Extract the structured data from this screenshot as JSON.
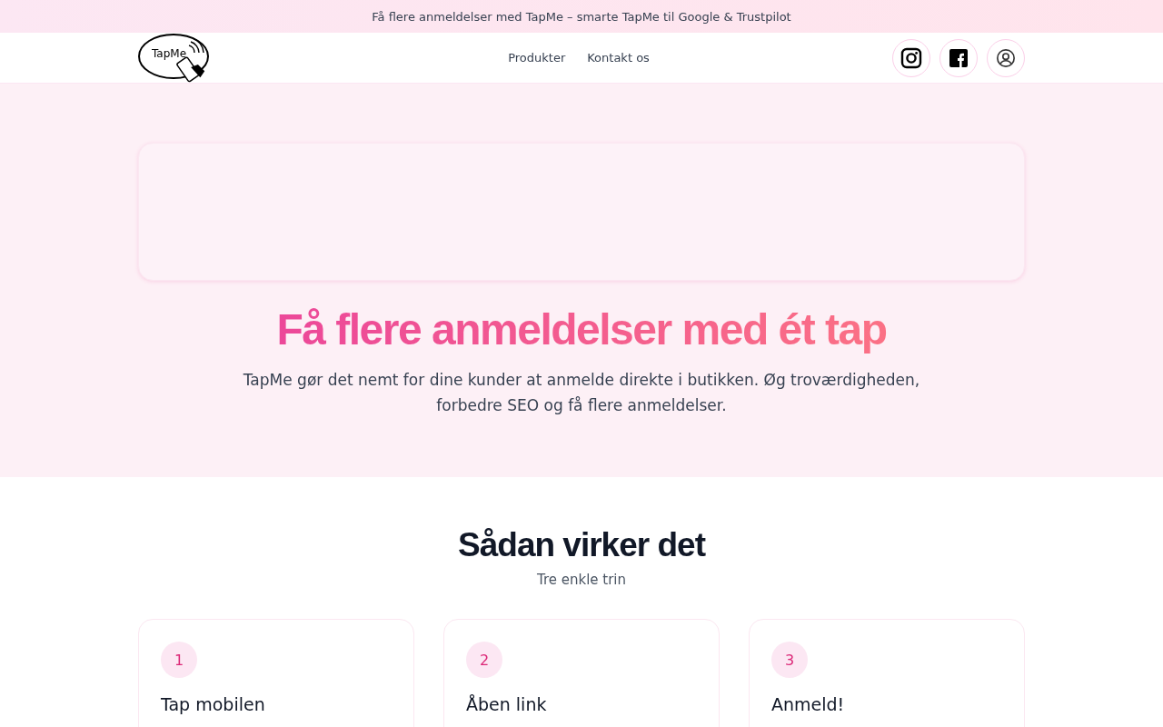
{
  "announcement": "Få flere anmeldelser med TapMe – smarte TapMe til Google & Trustpilot",
  "header": {
    "logo_text": "TapMe",
    "nav": [
      "Produkter",
      "Kontakt os"
    ]
  },
  "hero": {
    "title": "Få flere anmeldelser med ét tap",
    "text": "TapMe gør det nemt for dine kunder at anmelde direkte i butikken. Øg troværdigheden, forbedre SEO og få flere anmeldelser."
  },
  "how": {
    "title": "Sådan virker det",
    "subtitle": "Tre enkle trin",
    "steps": [
      {
        "number": "1",
        "title": "Tap mobilen"
      },
      {
        "number": "2",
        "title": "Åben link"
      },
      {
        "number": "3",
        "title": "Anmeld!"
      }
    ]
  }
}
